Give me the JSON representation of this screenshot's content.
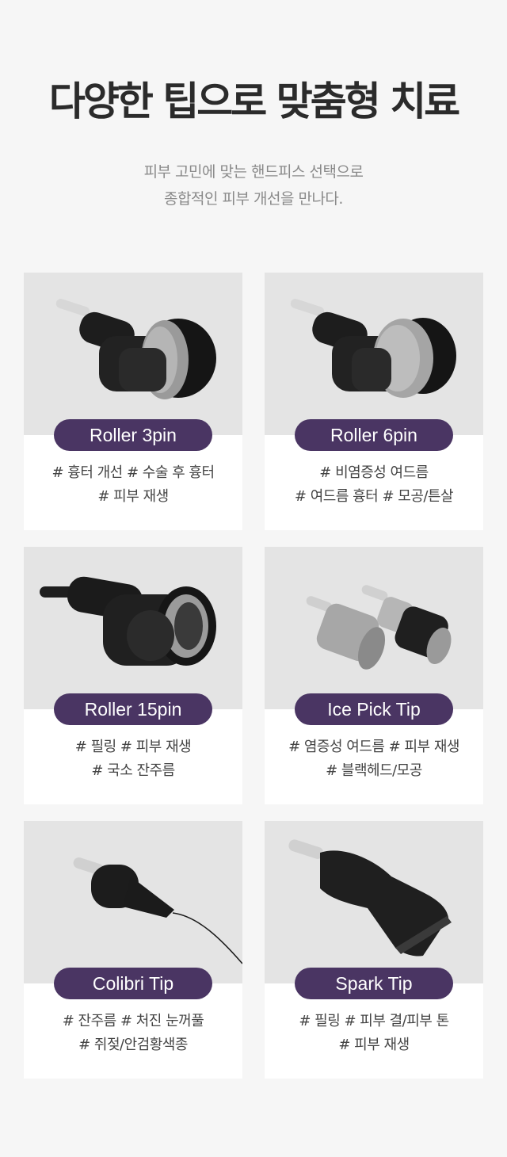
{
  "heading": {
    "title": "다양한 팁으로 맞춤형 치료",
    "subtitle_line1": "피부 고민에 맞는 핸드피스 선택으로",
    "subtitle_line2": "종합적인 피부 개선을 만나다."
  },
  "tips": [
    {
      "name": "Roller 3pin",
      "tags_line1": "# 흉터 개선 # 수술 후 흉터",
      "tags_line2": "# 피부 재생"
    },
    {
      "name": "Roller 6pin",
      "tags_line1": "# 비염증성 여드름",
      "tags_line2": "# 여드름 흉터 # 모공/튼살"
    },
    {
      "name": "Roller 15pin",
      "tags_line1": "# 필링 # 피부 재생",
      "tags_line2": "# 국소 잔주름"
    },
    {
      "name": "Ice Pick Tip",
      "tags_line1": "# 염증성 여드름 # 피부 재생",
      "tags_line2": "# 블랙헤드/모공"
    },
    {
      "name": "Colibri Tip",
      "tags_line1": "# 잔주름 # 처진 눈꺼풀",
      "tags_line2": "# 쥐젖/안검황색종"
    },
    {
      "name": "Spark Tip",
      "tags_line1": "# 필링 # 피부 결/피부 톤",
      "tags_line2": "# 피부 재생"
    }
  ],
  "colors": {
    "pill": "#4a3563",
    "background": "#f6f6f6",
    "photo_bg": "#e4e4e4"
  }
}
